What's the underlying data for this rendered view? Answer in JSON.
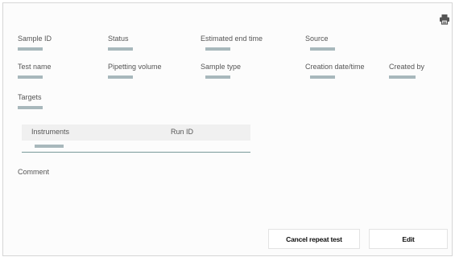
{
  "icons": {
    "print": "print-icon"
  },
  "fields": {
    "sample_id": "Sample ID",
    "status": "Status",
    "estimated_end_time": "Estimated end time",
    "source": "Source",
    "test_name": "Test name",
    "pipetting_volume": "Pipetting volume",
    "sample_type": "Sample type",
    "creation_datetime": "Creation date/time",
    "created_by": "Created by",
    "targets": "Targets"
  },
  "instruments_table": {
    "columns": [
      "Instruments",
      "Run ID"
    ]
  },
  "comment_label": "Comment",
  "buttons": {
    "cancel_repeat_test": "Cancel repeat test",
    "edit": "Edit"
  },
  "colors": {
    "placeholder": "#a8b8bc",
    "table_header_bg": "#f0f0f0",
    "table_rule": "#7a9a9a"
  }
}
